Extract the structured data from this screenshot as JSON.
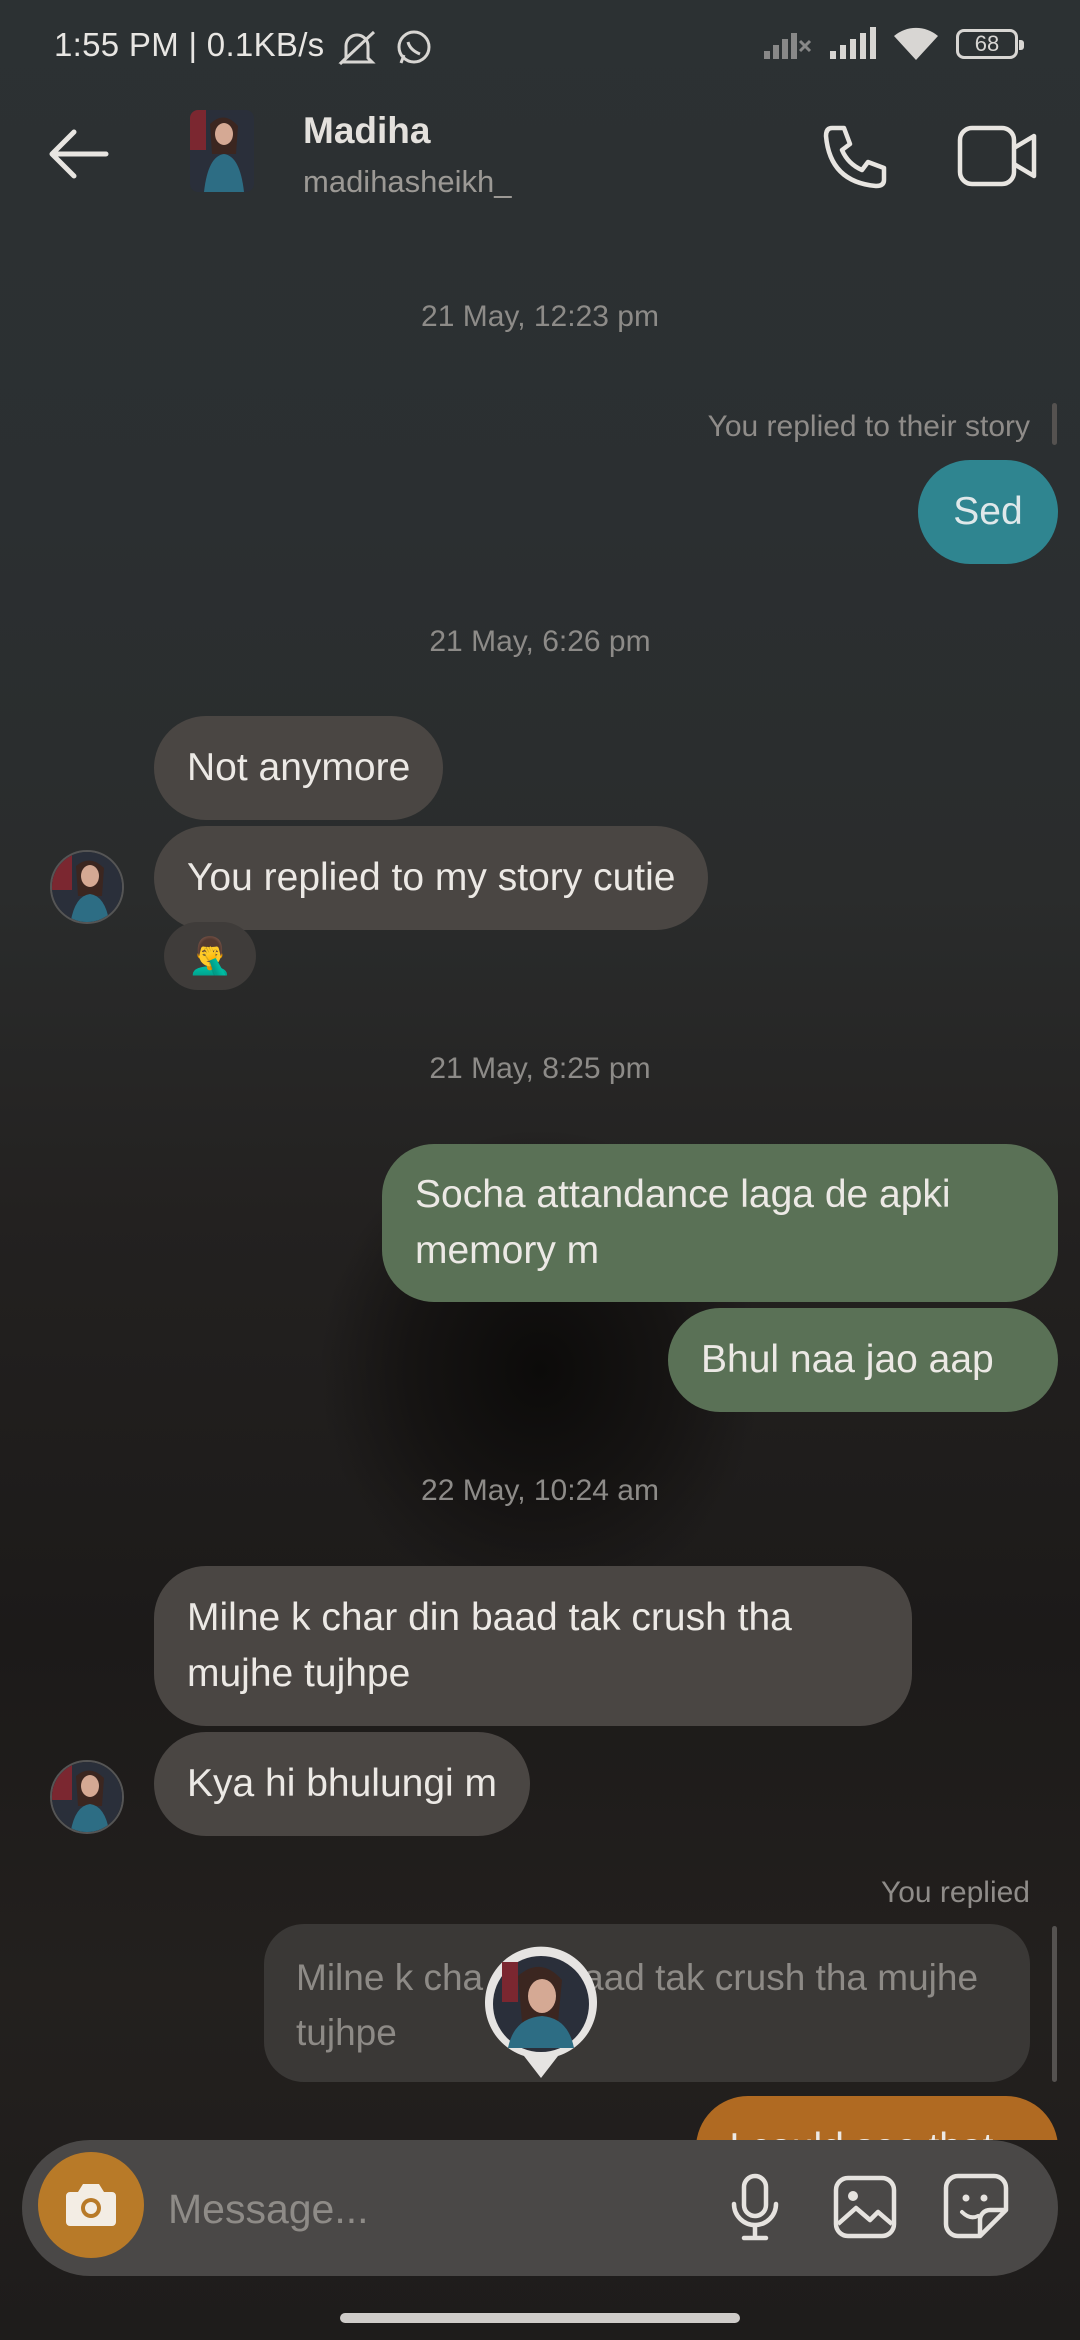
{
  "status_bar": {
    "time_speed": "1:55 PM | 0.1KB/s",
    "battery": "68"
  },
  "header": {
    "name": "Madiha",
    "username": "madihasheikh_"
  },
  "messages": {
    "ts1": "21 May, 12:23 pm",
    "story_reply_label": "You replied to their story",
    "sed": "Sed",
    "ts2": "21 May, 6:26 pm",
    "not_anymore": "Not anymore",
    "replied_story_cutie": "You replied to my story cutie",
    "reaction": "🤦‍♂️",
    "ts3": "21 May, 8:25 pm",
    "socha_line1": "Socha attandance laga de apki",
    "socha_line2": "memory m",
    "bhul": "Bhul naa jao aap",
    "ts4": "22 May, 10:24 am",
    "milne_line1": "Milne k char din baad tak crush tha",
    "milne_line2": "mujhe tujhpe",
    "kya": "Kya hi bhulungi m",
    "you_replied": "You replied",
    "quoted_line1": "Milne k cha",
    "quoted_line1b": "aad tak crush tha mujhe",
    "quoted_line2": "tujhpe",
    "partial_orange": "I could see that"
  },
  "composer": {
    "placeholder": "Message..."
  },
  "icons": {
    "back": "arrow-left-icon",
    "call": "phone-icon",
    "video": "video-camera-icon",
    "camera": "camera-icon",
    "mic": "microphone-icon",
    "gallery": "image-icon",
    "sticker": "sticker-icon"
  },
  "colors": {
    "sent_teal": "#2f8590",
    "sent_green": "#5a7156",
    "sent_orange": "#b06a22",
    "received": "#4a4643",
    "camera_button": "#b87a28"
  }
}
